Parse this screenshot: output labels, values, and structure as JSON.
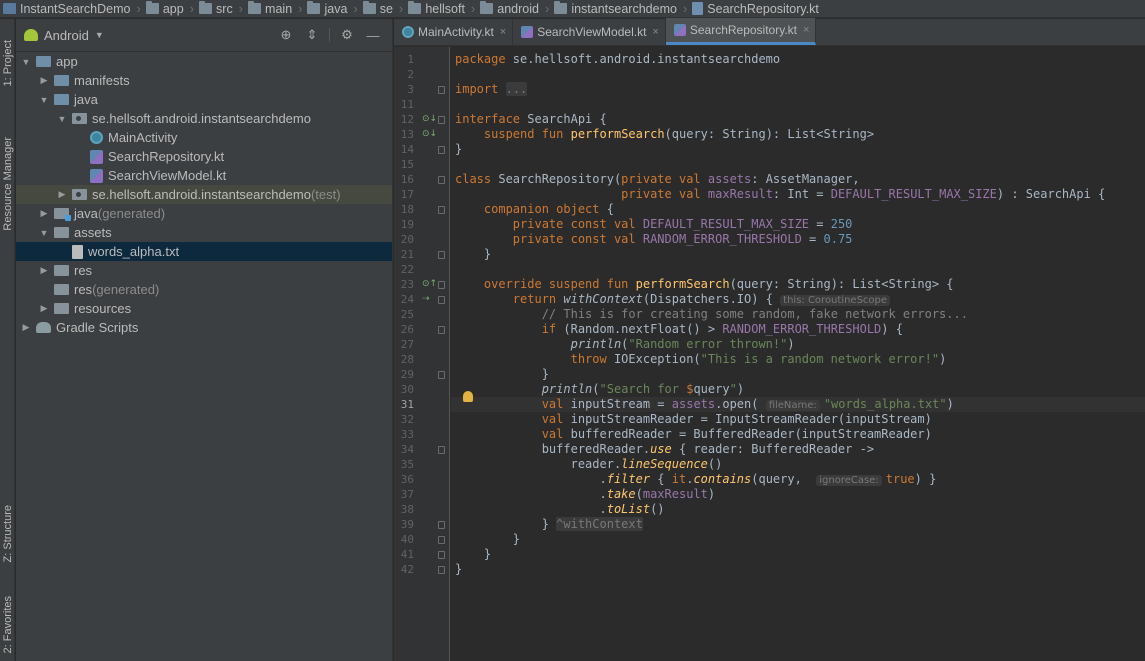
{
  "breadcrumb": [
    "InstantSearchDemo",
    "app",
    "src",
    "main",
    "java",
    "se",
    "hellsoft",
    "android",
    "instantsearchdemo",
    "SearchRepository.kt"
  ],
  "left_strip": {
    "project": "1: Project",
    "resource_manager": "Resource Manager",
    "structure": "Z: Structure",
    "favorites": "2: Favorites"
  },
  "panel": {
    "view_label": "Android"
  },
  "tree": [
    {
      "label": "app",
      "suffix": "",
      "indent": 0,
      "arrow": "▼",
      "icon": "t-folder blue"
    },
    {
      "label": "manifests",
      "suffix": "",
      "indent": 1,
      "arrow": "▶",
      "icon": "t-folder blue"
    },
    {
      "label": "java",
      "suffix": "",
      "indent": 1,
      "arrow": "▼",
      "icon": "t-folder blue"
    },
    {
      "label": "se.hellsoft.android.instantsearchdemo",
      "suffix": "",
      "indent": 2,
      "arrow": "▼",
      "icon": "t-pkg"
    },
    {
      "label": "MainActivity",
      "suffix": "",
      "indent": 3,
      "arrow": "",
      "icon": "t-activity"
    },
    {
      "label": "SearchRepository.kt",
      "suffix": "",
      "indent": 3,
      "arrow": "",
      "icon": "t-kotlin"
    },
    {
      "label": "SearchViewModel.kt",
      "suffix": "",
      "indent": 3,
      "arrow": "",
      "icon": "t-kotlin"
    },
    {
      "label": "se.hellsoft.android.instantsearchdemo",
      "suffix": " (test)",
      "indent": 2,
      "arrow": "▶",
      "icon": "t-pkg",
      "state": "test"
    },
    {
      "label": "java",
      "suffix": " (generated)",
      "indent": 1,
      "arrow": "▶",
      "icon": "t-folder src"
    },
    {
      "label": "assets",
      "suffix": "",
      "indent": 1,
      "arrow": "▼",
      "icon": "t-folder"
    },
    {
      "label": "words_alpha.txt",
      "suffix": "",
      "indent": 2,
      "arrow": "",
      "icon": "t-txt",
      "state": "selected"
    },
    {
      "label": "res",
      "suffix": "",
      "indent": 1,
      "arrow": "▶",
      "icon": "t-folder"
    },
    {
      "label": "res",
      "suffix": " (generated)",
      "indent": 1,
      "arrow": "",
      "icon": "t-folder"
    },
    {
      "label": "resources",
      "suffix": "",
      "indent": 1,
      "arrow": "▶",
      "icon": "t-folder"
    },
    {
      "label": "Gradle Scripts",
      "suffix": "",
      "indent": 0,
      "arrow": "▶",
      "icon": "t-gradle"
    }
  ],
  "tabs": [
    {
      "label": "MainActivity.kt",
      "active": false
    },
    {
      "label": "SearchViewModel.kt",
      "active": false
    },
    {
      "label": "SearchRepository.kt",
      "active": true
    }
  ],
  "current_line": 31,
  "code": [
    {
      "n": 1,
      "html": "<span class=\"kw\">package</span> se.hellsoft.android.instantsearchdemo"
    },
    {
      "n": 2,
      "html": ""
    },
    {
      "n": 3,
      "html": "<span class=\"kw\">import</span> <span class=\"imp\">...</span>"
    },
    {
      "n": 11,
      "html": ""
    },
    {
      "n": 12,
      "html": "<span class=\"kw\">interface</span> SearchApi {"
    },
    {
      "n": 13,
      "html": "    <span class=\"kw\">suspend fun</span> <span class=\"fn\">performSearch</span>(query: String): List&lt;String&gt;"
    },
    {
      "n": 14,
      "html": "}"
    },
    {
      "n": 15,
      "html": ""
    },
    {
      "n": 16,
      "html": "<span class=\"kw\">class</span> SearchRepository(<span class=\"kw\">private val</span> <span class=\"cst\">assets</span>: AssetManager,"
    },
    {
      "n": 17,
      "html": "                       <span class=\"kw\">private val</span> <span class=\"cst\">maxResult</span>: Int = <span class=\"cst\">DEFAULT_RESULT_MAX_SIZE</span>) : SearchApi {"
    },
    {
      "n": 18,
      "html": "    <span class=\"kw\">companion object</span> {"
    },
    {
      "n": 19,
      "html": "        <span class=\"kw\">private const val</span> <span class=\"cst\">DEFAULT_RESULT_MAX_SIZE</span> = <span class=\"num\">250</span>"
    },
    {
      "n": 20,
      "html": "        <span class=\"kw\">private const val</span> <span class=\"cst\">RANDOM_ERROR_THRESHOLD</span> = <span class=\"num\">0.75</span>"
    },
    {
      "n": 21,
      "html": "    }"
    },
    {
      "n": 22,
      "html": ""
    },
    {
      "n": 23,
      "html": "    <span class=\"kw\">override suspend fun</span> <span class=\"fn\">performSearch</span>(query: String): List&lt;String&gt; {"
    },
    {
      "n": 24,
      "html": "        <span class=\"kw\">return</span> <span class=\"it\">withContext</span>(Dispatchers.IO) { <span class=\"hint\">this: CoroutineScope</span>"
    },
    {
      "n": 25,
      "html": "            <span class=\"cmt\">// This is for creating some random, fake network errors...</span>"
    },
    {
      "n": 26,
      "html": "            <span class=\"kw\">if</span> (Random.nextFloat() &gt; <span class=\"cst\">RANDOM_ERROR_THRESHOLD</span>) {"
    },
    {
      "n": 27,
      "html": "                <span class=\"it\">println</span>(<span class=\"str\">\"Random error thrown!\"</span>)"
    },
    {
      "n": 28,
      "html": "                <span class=\"kw\">throw</span> IOException(<span class=\"str\">\"This is a random network error!\"</span>)"
    },
    {
      "n": 29,
      "html": "            }"
    },
    {
      "n": 30,
      "html": "            <span class=\"it\">println</span>(<span class=\"str\">\"Search for </span><span class=\"kw\">$</span>query<span class=\"str\">\"</span>)"
    },
    {
      "n": 31,
      "html": "            <span class=\"kw\">val</span> inputStream = <span class=\"cst\">assets</span>.open( <span class=\"hint\">fileName:</span><span class=\"str\">\"words_alpha.txt\"</span>)"
    },
    {
      "n": 32,
      "html": "            <span class=\"kw\">val</span> inputStreamReader = InputStreamReader(inputStream)"
    },
    {
      "n": 33,
      "html": "            <span class=\"kw\">val</span> bufferedReader = BufferedReader(inputStreamReader)"
    },
    {
      "n": 34,
      "html": "            bufferedReader.<span class=\"ext\">use</span> { reader: BufferedReader -&gt;"
    },
    {
      "n": 35,
      "html": "                reader.<span class=\"ext\">lineSequence</span>()"
    },
    {
      "n": 36,
      "html": "                    .<span class=\"ext\">filter</span> { <span class=\"kw\">it</span>.<span class=\"ext\">contains</span>(query,  <span class=\"hint\">ignoreCase:</span><span class=\"kw\">true</span>) }"
    },
    {
      "n": 37,
      "html": "                    .<span class=\"ext\">take</span>(<span class=\"cst\">maxResult</span>)"
    },
    {
      "n": 38,
      "html": "                    .<span class=\"ext\">toList</span>()"
    },
    {
      "n": 39,
      "html": "            } <span class=\"imp\">^withContext</span>"
    },
    {
      "n": 40,
      "html": "        }"
    },
    {
      "n": 41,
      "html": "    }"
    },
    {
      "n": 42,
      "html": "}"
    }
  ]
}
